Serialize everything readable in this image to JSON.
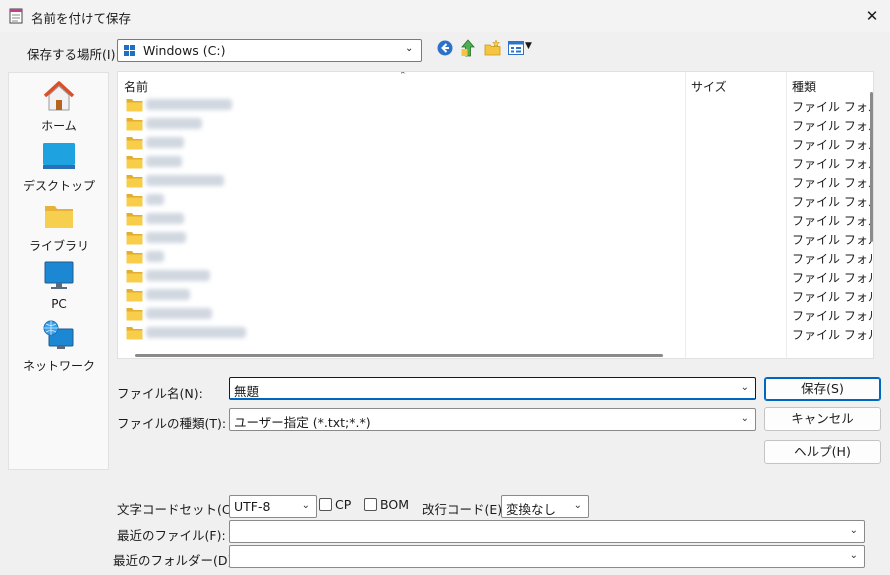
{
  "window": {
    "title": "名前を付けて保存",
    "close_label": "✕"
  },
  "location": {
    "label": "保存する場所(I):",
    "value": "Windows (C:)"
  },
  "places": [
    {
      "label": "ホーム",
      "icon": "home-icon"
    },
    {
      "label": "デスクトップ",
      "icon": "desktop-icon"
    },
    {
      "label": "ライブラリ",
      "icon": "library-folder-icon"
    },
    {
      "label": "PC",
      "icon": "pc-monitor-icon"
    },
    {
      "label": "ネットワーク",
      "icon": "network-icon"
    }
  ],
  "filelist": {
    "columns": {
      "name": "名前",
      "size": "サイズ",
      "type": "種類"
    },
    "rows_type_label": "ファイル フォルダー",
    "row_count_visible": 13
  },
  "filename": {
    "label": "ファイル名(N):",
    "value": "無題"
  },
  "filetype": {
    "label": "ファイルの種類(T):",
    "value": "ユーザー指定 (*.txt;*.*)"
  },
  "buttons": {
    "save": "保存(S)",
    "cancel": "キャンセル",
    "help": "ヘルプ(H)"
  },
  "encoding": {
    "label": "文字コードセット(C):",
    "value": "UTF-8",
    "cp_label": "CP",
    "bom_label": "BOM",
    "newline_label": "改行コード(E):",
    "newline_value": "変換なし"
  },
  "recent": {
    "files_label": "最近のファイル(F):",
    "folders_label": "最近のフォルダー(D):"
  },
  "colors": {
    "accent": "#0067c0",
    "folder": "#f5c542",
    "background": "#f0f0f0"
  }
}
